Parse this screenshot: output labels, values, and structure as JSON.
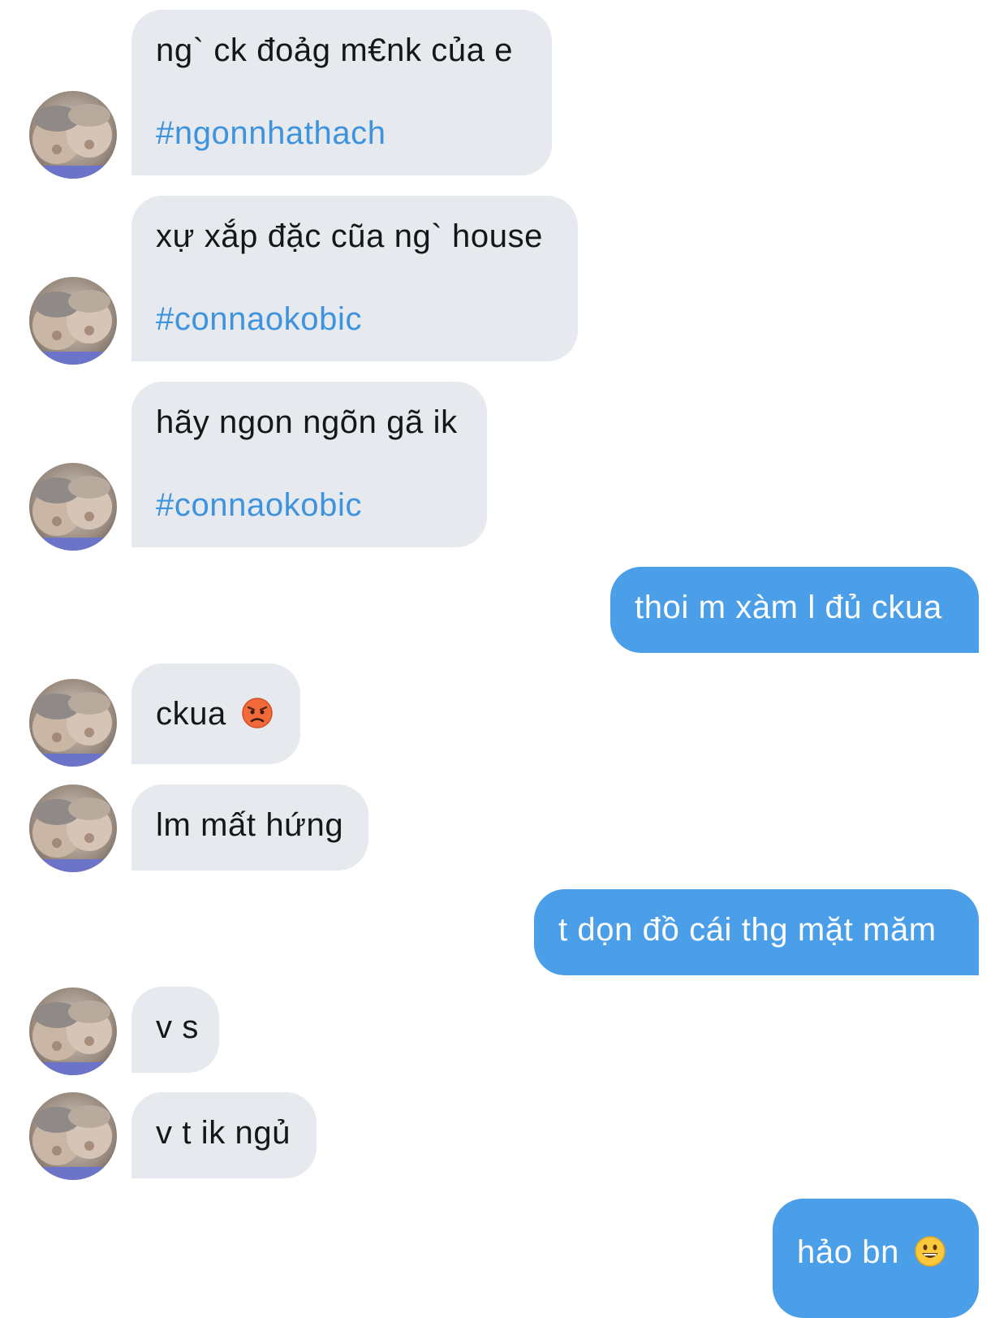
{
  "messages": [
    {
      "sender": "them",
      "text": "ng` ck đoảg m€nk của e",
      "hashtag": "#ngonnhathach"
    },
    {
      "sender": "them",
      "text": "xự xắp đặc cũa ng` house",
      "hashtag": "#connaokobic"
    },
    {
      "sender": "them",
      "text": "hãy ngon ngõn gã ik",
      "hashtag": "#connaokobic"
    },
    {
      "sender": "me",
      "text": "thoi m xàm l đủ ckua"
    },
    {
      "sender": "them",
      "text": "ckua",
      "emoji": "pouting-face"
    },
    {
      "sender": "them",
      "text": "lm mất hứng"
    },
    {
      "sender": "me",
      "text": "t dọn đồ cái thg mặt măm"
    },
    {
      "sender": "them",
      "text": "v s"
    },
    {
      "sender": "them",
      "text": "v t ik ngủ"
    },
    {
      "sender": "me",
      "text": "hảo bn",
      "emoji": "grinning-face"
    }
  ],
  "colors": {
    "incoming_bubble": "#e6e9ed",
    "outgoing_bubble": "#4a9fe8",
    "hashtag": "#3d93de",
    "text_dark": "#14171a",
    "text_light": "#ffffff"
  }
}
